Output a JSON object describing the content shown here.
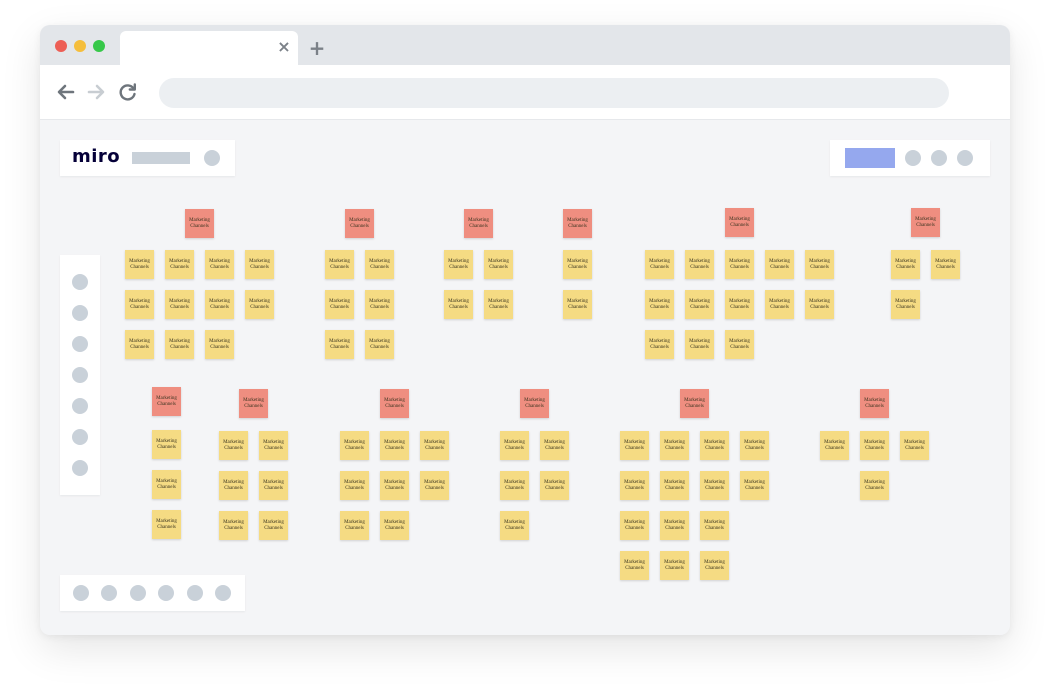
{
  "browser": {
    "traffic_light_colors": {
      "close": "#ed5f56",
      "minimize": "#f5be3c",
      "maximize": "#37c84a"
    },
    "tab": {
      "close_icon": "×"
    },
    "new_tab_icon": "+",
    "toolbar": {
      "back_icon": "arrow-left-icon",
      "forward_icon": "arrow-right-icon",
      "reload_icon": "reload-icon",
      "address_value": ""
    }
  },
  "app": {
    "logo": "miro",
    "colors": {
      "note_yellow": "#f5db83",
      "note_red": "#ef8e80",
      "accent": "#95a8ee",
      "placeholder_gray": "#c9d1d9"
    }
  },
  "board": {
    "note_text": "Marketing Channels"
  }
}
